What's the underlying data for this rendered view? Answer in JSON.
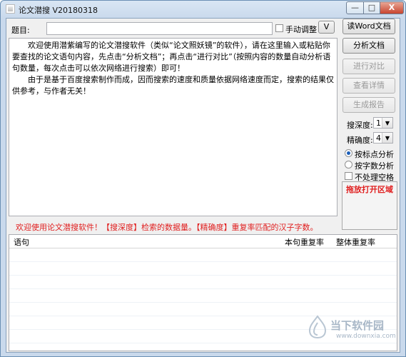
{
  "window": {
    "title": "论文潜搜 V20180318",
    "min_label": "—",
    "max_label": "□",
    "close_label": "X"
  },
  "topic": {
    "label": "题目:",
    "value": "",
    "manual_adjust_label": "手动调整",
    "dropdown_glyph": "V"
  },
  "content": {
    "paragraph1": "欢迎使用潜紫编写的论文潜搜软件（类似“论文照妖镜”的软件），请在这里输入或粘贴你要查找的论文语句内容，先点击“分析文档”；再点击“进行对比”（按照内容的数量自动分析语句数量，每次点击可以依次网络进行搜索）即可！",
    "paragraph2": "由于是基于百度搜索制作而成，因而搜索的速度和质量依据网络速度而定，搜索的结果仅供参考，与作者无关！"
  },
  "buttons": {
    "read_word": "读Word文档",
    "analyze": "分析文档",
    "compare": "进行对比",
    "details": "查看详情",
    "report": "生成报告"
  },
  "settings": {
    "search_depth_label": "搜深度:",
    "search_depth_value": "1",
    "precision_label": "精确度:",
    "precision_value": "4",
    "by_punctuation_label": "按标点分析",
    "by_charcount_label": "按字数分析",
    "ignore_spaces_label": "不处理空格",
    "drop_zone_label": "拖放打开区域"
  },
  "hint": {
    "text": "欢迎使用论文潜搜软件！【搜深度】检索的数据量。【精确度】重复率匹配的汉子字数。"
  },
  "results": {
    "col_sentence": "语句",
    "col_sentence_rate": "本句重复率",
    "col_total_rate": "整体重复率"
  },
  "watermark": {
    "brand": "当下软件园",
    "url": "www.downxia.com"
  }
}
